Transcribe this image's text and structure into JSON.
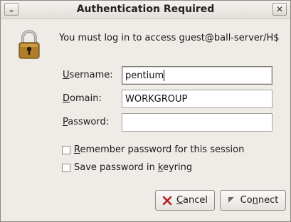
{
  "window": {
    "title": "Authentication Required",
    "menu_glyph": "⌄",
    "close_glyph": "✕"
  },
  "message": "You must log in to access guest@ball-server/H$",
  "form": {
    "username": {
      "label_first": "U",
      "label_rest": "sername:",
      "value": "pentium"
    },
    "domain": {
      "label_first": "D",
      "label_rest": "omain:",
      "value": "WORKGROUP"
    },
    "password": {
      "label_first": "P",
      "label_rest": "assword:",
      "value": ""
    }
  },
  "options": {
    "remember_session": {
      "label_first": "R",
      "label_rest": "emember password for this session",
      "checked": false
    },
    "save_keyring": {
      "label_pre": "Save password in ",
      "label_first": "k",
      "label_rest": "eyring",
      "checked": false
    }
  },
  "buttons": {
    "cancel": {
      "label_first": "C",
      "label_rest": "ancel",
      "icon": "cancel-x-icon"
    },
    "connect": {
      "label_pre": "Co",
      "label_first": "n",
      "label_rest": "nect",
      "icon": "connect-icon"
    }
  },
  "colors": {
    "lock_body": "#b07d2a",
    "cancel_icon": "#c62828"
  }
}
